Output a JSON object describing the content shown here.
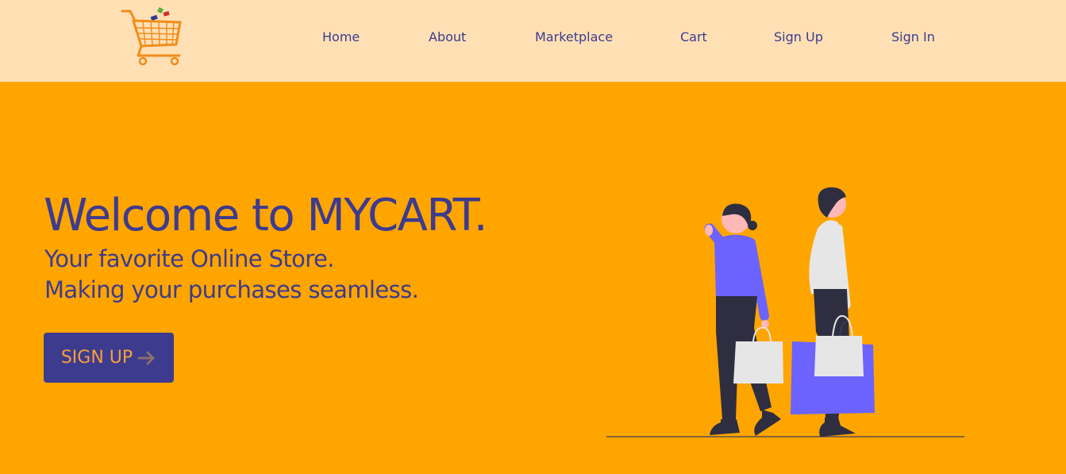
{
  "nav": {
    "logo_icon": "shopping-cart-icon",
    "items": [
      {
        "label": "Home"
      },
      {
        "label": "About"
      },
      {
        "label": "Marketplace"
      },
      {
        "label": "Cart"
      },
      {
        "label": "Sign Up"
      },
      {
        "label": "Sign In"
      }
    ]
  },
  "hero": {
    "title": "Welcome to MYCART.",
    "subtitle_line1": "Your favorite Online Store.",
    "subtitle_line2": "Making your purchases seamless.",
    "cta_label": "SIGN UP",
    "cta_icon": "arrow-right-icon",
    "illustration": "shoppers-with-bags-illustration"
  },
  "colors": {
    "nav_background": "#FFE0B5",
    "page_background": "#FFA500",
    "primary_text": "#3D3B8E",
    "button_background": "#3D3B8E",
    "button_text": "#F5A03A",
    "accent_purple": "#6C63FF"
  }
}
